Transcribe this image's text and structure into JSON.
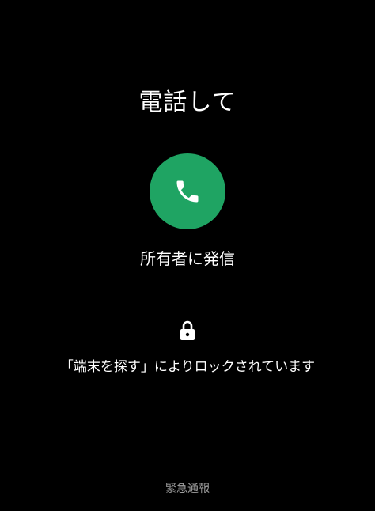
{
  "lock_screen": {
    "title": "電話して",
    "call_label": "所有者に発信",
    "lock_message": "「端末を探す」によりロックされています",
    "emergency_label": "緊急通報",
    "icons": {
      "call": "phone-icon",
      "lock": "lock-icon"
    },
    "colors": {
      "background": "#000000",
      "call_button": "#1fa463",
      "text": "#ffffff",
      "secondary_text": "#9e9e9e"
    }
  }
}
